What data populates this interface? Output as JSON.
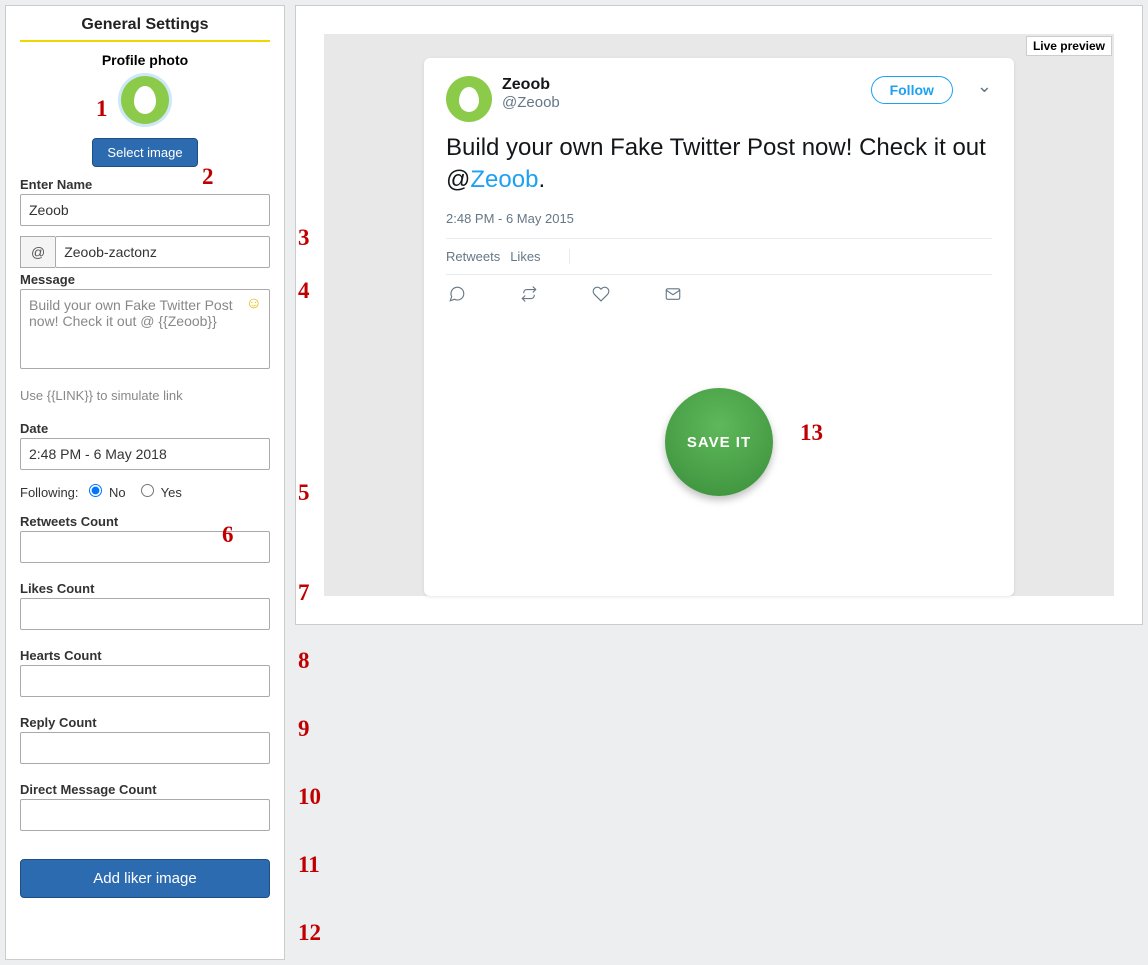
{
  "sidebar": {
    "title": "General Settings",
    "profile_photo_label": "Profile photo",
    "select_image_label": "Select image",
    "enter_name_label": "Enter Name",
    "name_value": "Zeoob",
    "at_symbol": "@",
    "username_value": "Zeoob-zactonz",
    "message_label": "Message",
    "message_value": "Build your own Fake Twitter Post now! Check it out @ {{Zeoob}}",
    "link_hint": "Use {{LINK}} to simulate link",
    "date_label": "Date",
    "date_value": "2:48 PM - 6 May 2018",
    "following_label": "Following:",
    "following_no": "No",
    "following_yes": "Yes",
    "retweets_label": "Retweets Count",
    "retweets_value": "",
    "likes_label": "Likes Count",
    "likes_value": "",
    "hearts_label": "Hearts Count",
    "hearts_value": "",
    "reply_label": "Reply Count",
    "reply_value": "",
    "dm_label": "Direct Message Count",
    "dm_value": "",
    "add_liker_label": "Add liker image"
  },
  "preview": {
    "live_tag": "Live preview",
    "tweet": {
      "name": "Zeoob",
      "handle": "@Zeoob",
      "follow_label": "Follow",
      "body_plain": "Build your own Fake Twitter Post now! Check it out @",
      "body_link": "Zeoob",
      "body_tail": ".",
      "date": "2:48 PM - 6 May 2015",
      "retweets_label": "Retweets",
      "likes_label": "Likes"
    },
    "save_label": "SAVE IT"
  },
  "annotations": {
    "a1": "1",
    "a2": "2",
    "a3": "3",
    "a4": "4",
    "a5": "5",
    "a6": "6",
    "a7": "7",
    "a8": "8",
    "a9": "9",
    "a10": "10",
    "a11": "11",
    "a12": "12",
    "a13": "13"
  }
}
